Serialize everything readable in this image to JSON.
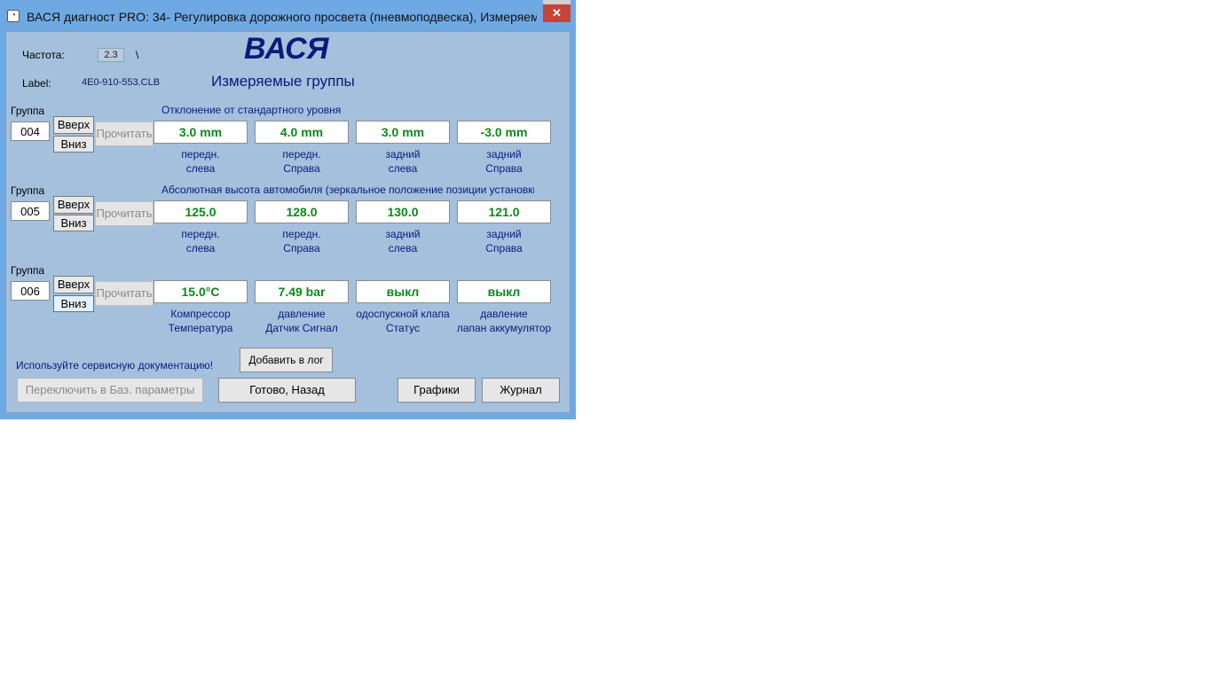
{
  "window": {
    "title": "ВАСЯ диагност PRO: 34- Регулировка дорожного просвета (пневмоподвеска),  Измеряемые группы",
    "close_glyph": "✕"
  },
  "header": {
    "freq_label": "Частота:",
    "freq_value": "2.3",
    "freq_indicator": "\\",
    "label_label": "Label:",
    "label_value": "4E0-910-553.CLB",
    "brand": "ВАСЯ",
    "subtitle": "Измеряемые группы"
  },
  "groups": [
    {
      "group_label": "Группа",
      "number": "004",
      "up_label": "Вверх",
      "down_label": "Вниз",
      "read_label": "Прочитать",
      "title": "Отклонение от стандартного уровня",
      "fields": [
        {
          "value": "3.0 mm",
          "line1": "передн.",
          "line2": "слева"
        },
        {
          "value": "4.0 mm",
          "line1": "передн.",
          "line2": "Справа"
        },
        {
          "value": "3.0 mm",
          "line1": "задний",
          "line2": "слева"
        },
        {
          "value": "-3.0 mm",
          "line1": "задний",
          "line2": "Справа"
        }
      ]
    },
    {
      "group_label": "Группа",
      "number": "005",
      "up_label": "Вверх",
      "down_label": "Вниз",
      "read_label": "Прочитать",
      "title": "Абсолютная высота автомобиля (зеркальное положение позиции установки)",
      "fields": [
        {
          "value": "125.0",
          "line1": "передн.",
          "line2": "слева"
        },
        {
          "value": "128.0",
          "line1": "передн.",
          "line2": "Справа"
        },
        {
          "value": "130.0",
          "line1": "задний",
          "line2": "слева"
        },
        {
          "value": "121.0",
          "line1": "задний",
          "line2": "Справа"
        }
      ]
    },
    {
      "group_label": "Группа",
      "number": "006",
      "up_label": "Вверх",
      "down_label": "Вниз",
      "read_label": "Прочитать",
      "title": "",
      "fields": [
        {
          "value": "15.0°C",
          "line1": "Компрессор",
          "line2": "Температура"
        },
        {
          "value": "7.49 bar",
          "line1": "давление",
          "line2": "Датчик Сигнал"
        },
        {
          "value": "выкл",
          "line1": "одоспускной клапа",
          "line2": "Статус"
        },
        {
          "value": "выкл",
          "line1": "давление",
          "line2": "лапан аккумулятор"
        }
      ]
    }
  ],
  "footer": {
    "hint": "Используйте сервисную документацию!",
    "add_log": "Добавить в лог",
    "switch_basic": "Переключить в Баз. параметры",
    "done_back": "Готово, Назад",
    "graphs": "Графики",
    "journal": "Журнал"
  }
}
